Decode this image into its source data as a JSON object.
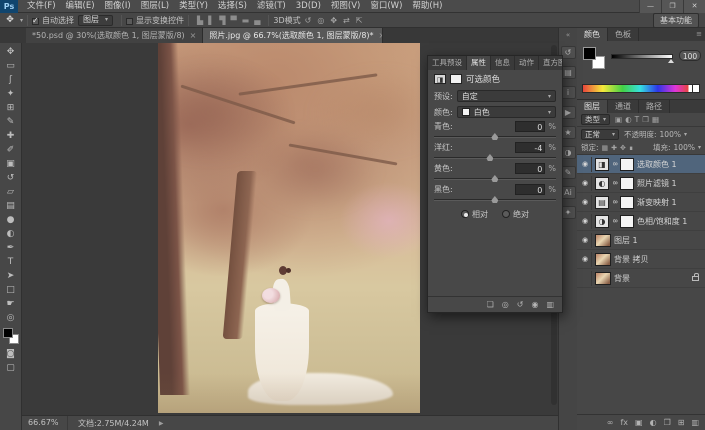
{
  "app": {
    "logo": "Ps",
    "workspace": "基本功能",
    "window_controls": {
      "minimize": "—",
      "restore": "❐",
      "close": "✕"
    }
  },
  "menu": {
    "items": [
      {
        "label": "文件(F)"
      },
      {
        "label": "编辑(E)"
      },
      {
        "label": "图像(I)"
      },
      {
        "label": "图层(L)"
      },
      {
        "label": "类型(Y)"
      },
      {
        "label": "选择(S)"
      },
      {
        "label": "滤镜(T)"
      },
      {
        "label": "3D(D)"
      },
      {
        "label": "视图(V)"
      },
      {
        "label": "窗口(W)"
      },
      {
        "label": "帮助(H)"
      }
    ]
  },
  "options": {
    "tool_glyph": "✥",
    "auto_select_label": "自动选择",
    "auto_select_value": "图层",
    "show_transform_label": "显示变换控件",
    "align_icons": [
      {
        "name": "align-left-icon",
        "glyph": "▙"
      },
      {
        "name": "align-center-h-icon",
        "glyph": "▌"
      },
      {
        "name": "align-right-icon",
        "glyph": "▜"
      },
      {
        "name": "align-top-icon",
        "glyph": "▀"
      },
      {
        "name": "align-middle-icon",
        "glyph": "▬"
      },
      {
        "name": "align-bottom-icon",
        "glyph": "▄"
      }
    ],
    "mode_label": "3D模式",
    "mode_icons": [
      {
        "name": "3d-rotate-icon",
        "glyph": "↺"
      },
      {
        "name": "3d-roll-icon",
        "glyph": "◎"
      },
      {
        "name": "3d-drag-icon",
        "glyph": "✥"
      },
      {
        "name": "3d-slide-icon",
        "glyph": "⇄"
      },
      {
        "name": "3d-scale-icon",
        "glyph": "⇱"
      }
    ]
  },
  "tabs": [
    {
      "title": "*50.psd @ 30%(选取颜色 1, 图层蒙版/8)",
      "close": "×",
      "active": false
    },
    {
      "title": "照片.jpg @ 66.7%(选取颜色 1, 图层蒙版/8)*",
      "close": "×",
      "active": true
    }
  ],
  "toolbar": {
    "tools": [
      {
        "name": "move-tool",
        "glyph": "✥"
      },
      {
        "name": "marquee-tool",
        "glyph": "▭"
      },
      {
        "name": "lasso-tool",
        "glyph": "ʃ"
      },
      {
        "name": "quick-selection-tool",
        "glyph": "✦"
      },
      {
        "name": "crop-tool",
        "glyph": "⊞"
      },
      {
        "name": "eyedropper-tool",
        "glyph": "✎"
      },
      {
        "name": "healing-brush-tool",
        "glyph": "✚"
      },
      {
        "name": "brush-tool",
        "glyph": "✐"
      },
      {
        "name": "clone-stamp-tool",
        "glyph": "▣"
      },
      {
        "name": "history-brush-tool",
        "glyph": "↺"
      },
      {
        "name": "eraser-tool",
        "glyph": "▱"
      },
      {
        "name": "gradient-tool",
        "glyph": "▤"
      },
      {
        "name": "blur-tool",
        "glyph": "●"
      },
      {
        "name": "dodge-tool",
        "glyph": "◐"
      },
      {
        "name": "pen-tool",
        "glyph": "✒"
      },
      {
        "name": "type-tool",
        "glyph": "T"
      },
      {
        "name": "path-selection-tool",
        "glyph": "➤"
      },
      {
        "name": "rectangle-tool",
        "glyph": "□"
      },
      {
        "name": "hand-tool",
        "glyph": "☛"
      },
      {
        "name": "zoom-tool",
        "glyph": "◎"
      }
    ],
    "extra_tools": [
      {
        "name": "quick-mask-icon",
        "glyph": "◙"
      },
      {
        "name": "screen-mode-icon",
        "glyph": "▢"
      }
    ]
  },
  "properties": {
    "tabs": [
      {
        "label": "工具预设",
        "active": false
      },
      {
        "label": "属性",
        "active": true
      },
      {
        "label": "信息",
        "active": false
      },
      {
        "label": "动作",
        "active": false
      },
      {
        "label": "直方图",
        "active": false
      }
    ],
    "title": "可选颜色",
    "preset_label": "预设:",
    "preset_value": "自定",
    "color_label": "颜色:",
    "color_value": "白色",
    "sliders": [
      {
        "label": "青色:",
        "value": "0",
        "pct": "%",
        "pos": "47%"
      },
      {
        "label": "洋红:",
        "value": "-4",
        "pct": "%",
        "pos": "43%"
      },
      {
        "label": "黄色:",
        "value": "0",
        "pct": "%",
        "pos": "47%"
      },
      {
        "label": "黑色:",
        "value": "0",
        "pct": "%",
        "pos": "47%"
      }
    ],
    "relative_label": "相对",
    "absolute_label": "绝对",
    "footer_icons": [
      {
        "name": "clip-to-layer-icon",
        "glyph": "❏"
      },
      {
        "name": "previous-state-icon",
        "glyph": "◎"
      },
      {
        "name": "reset-icon",
        "glyph": "↺"
      },
      {
        "name": "visibility-icon",
        "glyph": "◉"
      },
      {
        "name": "delete-adjustment-icon",
        "glyph": "▥"
      }
    ]
  },
  "dock": {
    "collapse": "«",
    "icons": [
      {
        "name": "history-panel-icon",
        "glyph": "↺"
      },
      {
        "name": "navigator-panel-icon",
        "glyph": "▤"
      },
      {
        "name": "info-panel-icon",
        "glyph": "i"
      },
      {
        "name": "actions-panel-icon",
        "glyph": "▶"
      },
      {
        "name": "styles-panel-icon",
        "glyph": "★"
      },
      {
        "name": "adjustments-panel-icon",
        "glyph": "◑"
      },
      {
        "name": "paths-panel-icon",
        "glyph": "✎"
      },
      {
        "name": "ai-panel-icon",
        "glyph": "Ai"
      },
      {
        "name": "brush-panel-icon",
        "glyph": "✦"
      }
    ]
  },
  "color_panel": {
    "tabs": [
      {
        "label": "颜色",
        "active": true
      },
      {
        "label": "色板",
        "active": false
      }
    ],
    "slider_value": "100",
    "menu_icon": "≡"
  },
  "layers_panel": {
    "tabs": [
      {
        "label": "图层",
        "active": true
      },
      {
        "label": "通道",
        "active": false
      },
      {
        "label": "路径",
        "active": false
      }
    ],
    "menu_icon": "≡",
    "filter_label": "类型",
    "filter_icons": [
      {
        "name": "filter-pixel-icon",
        "glyph": "▣"
      },
      {
        "name": "filter-adjustment-icon",
        "glyph": "◐"
      },
      {
        "name": "filter-type-icon",
        "glyph": "T"
      },
      {
        "name": "filter-shape-icon",
        "glyph": "❒"
      },
      {
        "name": "filter-smart-icon",
        "glyph": "▦"
      }
    ],
    "blend_mode": "正常",
    "opacity_label": "不透明度:",
    "opacity_value": "100%",
    "lock_label": "锁定:",
    "lock_icons": [
      {
        "name": "lock-transparent-icon",
        "glyph": "▦"
      },
      {
        "name": "lock-pixels-icon",
        "glyph": "✚"
      },
      {
        "name": "lock-position-icon",
        "glyph": "✥"
      },
      {
        "name": "lock-all-icon",
        "glyph": "∎"
      }
    ],
    "fill_label": "填充:",
    "fill_value": "100%",
    "layers": [
      {
        "name": "选取颜色 1",
        "badge": "◨",
        "is_adj": true,
        "eye": "◉",
        "selected": true,
        "locked": false
      },
      {
        "name": "照片滤镜 1",
        "badge": "◐",
        "is_adj": true,
        "eye": "◉",
        "selected": false,
        "locked": false
      },
      {
        "name": "渐变映射 1",
        "badge": "▤",
        "is_adj": true,
        "eye": "◉",
        "selected": false,
        "locked": false
      },
      {
        "name": "色相/饱和度 1",
        "badge": "◑",
        "is_adj": true,
        "eye": "◉",
        "selected": false,
        "locked": false
      },
      {
        "name": "图层 1",
        "badge": "",
        "is_adj": false,
        "eye": "◉",
        "selected": false,
        "locked": false
      },
      {
        "name": "背景 拷贝",
        "badge": "",
        "is_adj": false,
        "eye": "◉",
        "selected": false,
        "locked": false
      },
      {
        "name": "背景",
        "badge": "",
        "is_adj": false,
        "eye": "",
        "selected": false,
        "locked": true
      }
    ],
    "footer_icons": [
      {
        "name": "link-layers-icon",
        "glyph": "∞"
      },
      {
        "name": "layer-style-icon",
        "glyph": "fx"
      },
      {
        "name": "add-mask-icon",
        "glyph": "▣"
      },
      {
        "name": "new-adjustment-icon",
        "glyph": "◐"
      },
      {
        "name": "new-group-icon",
        "glyph": "❒"
      },
      {
        "name": "new-layer-icon",
        "glyph": "⊞"
      },
      {
        "name": "delete-layer-icon",
        "glyph": "▥"
      }
    ]
  },
  "statusbar": {
    "zoom_value": "66.67%",
    "doc_info": "文档:2.75M/4.24M",
    "arrow": "▶"
  }
}
